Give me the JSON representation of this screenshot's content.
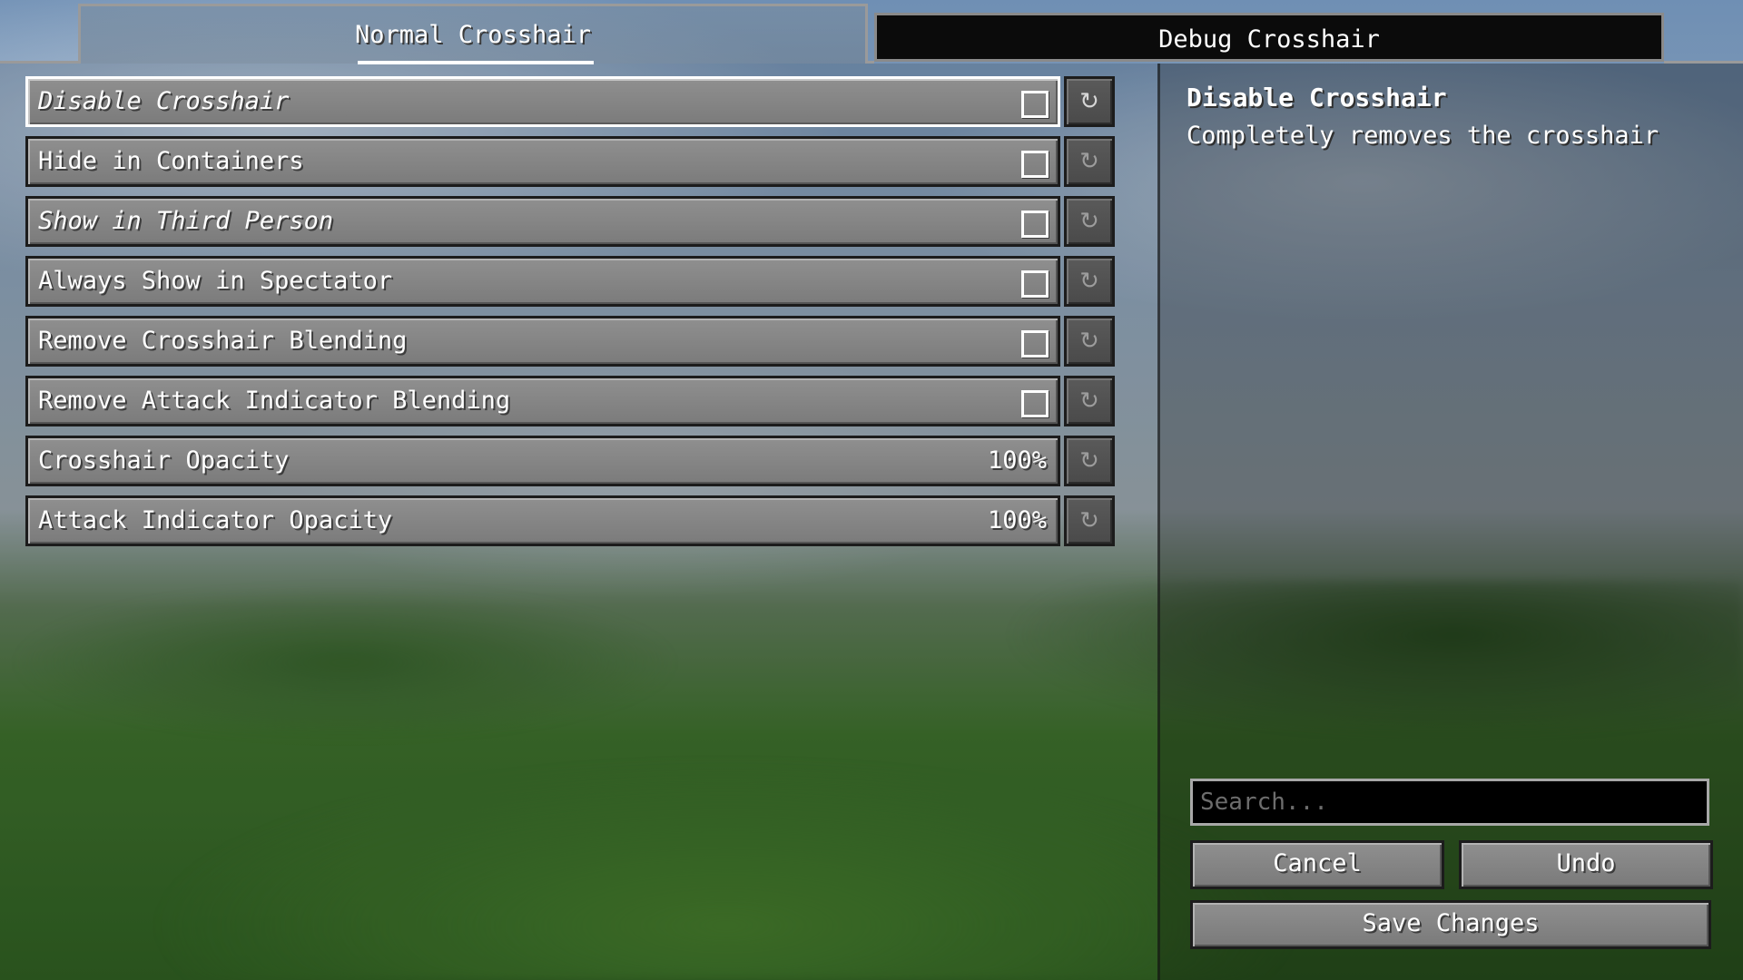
{
  "tabs": [
    {
      "label": "Normal Crosshair",
      "active": true
    },
    {
      "label": "Debug Crosshair",
      "active": false
    }
  ],
  "options": [
    {
      "label": "Disable Crosshair",
      "type": "toggle",
      "checked": false,
      "italic": true,
      "focused": true
    },
    {
      "label": "Hide in Containers",
      "type": "toggle",
      "checked": false,
      "italic": false
    },
    {
      "label": "Show in Third Person",
      "type": "toggle",
      "checked": false,
      "italic": true
    },
    {
      "label": "Always Show in Spectator",
      "type": "toggle",
      "checked": false,
      "italic": false
    },
    {
      "label": "Remove Crosshair Blending",
      "type": "toggle",
      "checked": false,
      "italic": false
    },
    {
      "label": "Remove Attack Indicator Blending",
      "type": "toggle",
      "checked": false,
      "italic": false
    },
    {
      "label": "Crosshair Opacity",
      "type": "value",
      "value": "100%",
      "italic": false
    },
    {
      "label": "Attack Indicator Opacity",
      "type": "value",
      "value": "100%",
      "italic": false
    }
  ],
  "reset_icon": "reset-icon",
  "reset_glyph": "↻",
  "description": {
    "title": "Disable Crosshair",
    "text": "Completely removes the crosshair"
  },
  "search": {
    "placeholder": "Search...",
    "value": ""
  },
  "buttons": {
    "cancel": "Cancel",
    "undo": "Undo",
    "save": "Save Changes"
  }
}
